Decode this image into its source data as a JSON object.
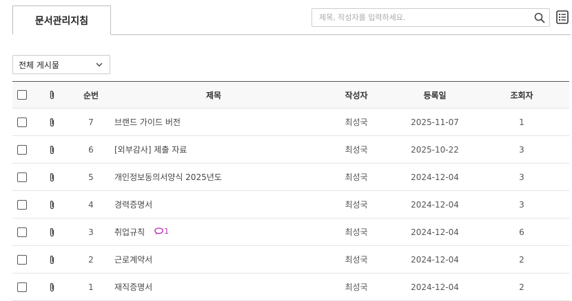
{
  "tab": {
    "label": "문서관리지침"
  },
  "search": {
    "placeholder": "제목, 작성자를 입력하세요."
  },
  "filter": {
    "selected": "전체 게시물"
  },
  "table": {
    "headers": {
      "number": "순번",
      "title": "제목",
      "author": "작성자",
      "date": "등록일",
      "views": "조회자"
    },
    "rows": [
      {
        "number": "7",
        "title": "브랜드 가이드 버전",
        "author": "최성국",
        "date": "2025-11-07",
        "views": "1",
        "comments": ""
      },
      {
        "number": "6",
        "title": "[외부감사] 제출 자료",
        "author": "최성국",
        "date": "2025-10-22",
        "views": "3",
        "comments": ""
      },
      {
        "number": "5",
        "title": "개인정보동의서양식 2025년도",
        "author": "최성국",
        "date": "2024-12-04",
        "views": "3",
        "comments": ""
      },
      {
        "number": "4",
        "title": "경력증명서",
        "author": "최성국",
        "date": "2024-12-04",
        "views": "3",
        "comments": ""
      },
      {
        "number": "3",
        "title": "취업규칙",
        "author": "최성국",
        "date": "2024-12-04",
        "views": "6",
        "comments": "1"
      },
      {
        "number": "2",
        "title": "근로계약서",
        "author": "최성국",
        "date": "2024-12-04",
        "views": "2",
        "comments": ""
      },
      {
        "number": "1",
        "title": "재직증명서",
        "author": "최성국",
        "date": "2024-12-04",
        "views": "2",
        "comments": ""
      }
    ]
  },
  "colors": {
    "comment_accent": "#c030b8",
    "header_border": "#555555",
    "row_border": "#e4e4e4"
  },
  "icons": {
    "search": "search-icon",
    "list": "list-view-icon",
    "attachment": "paperclip-icon",
    "comment": "comment-icon",
    "dropdown": "chevron-down-icon"
  }
}
